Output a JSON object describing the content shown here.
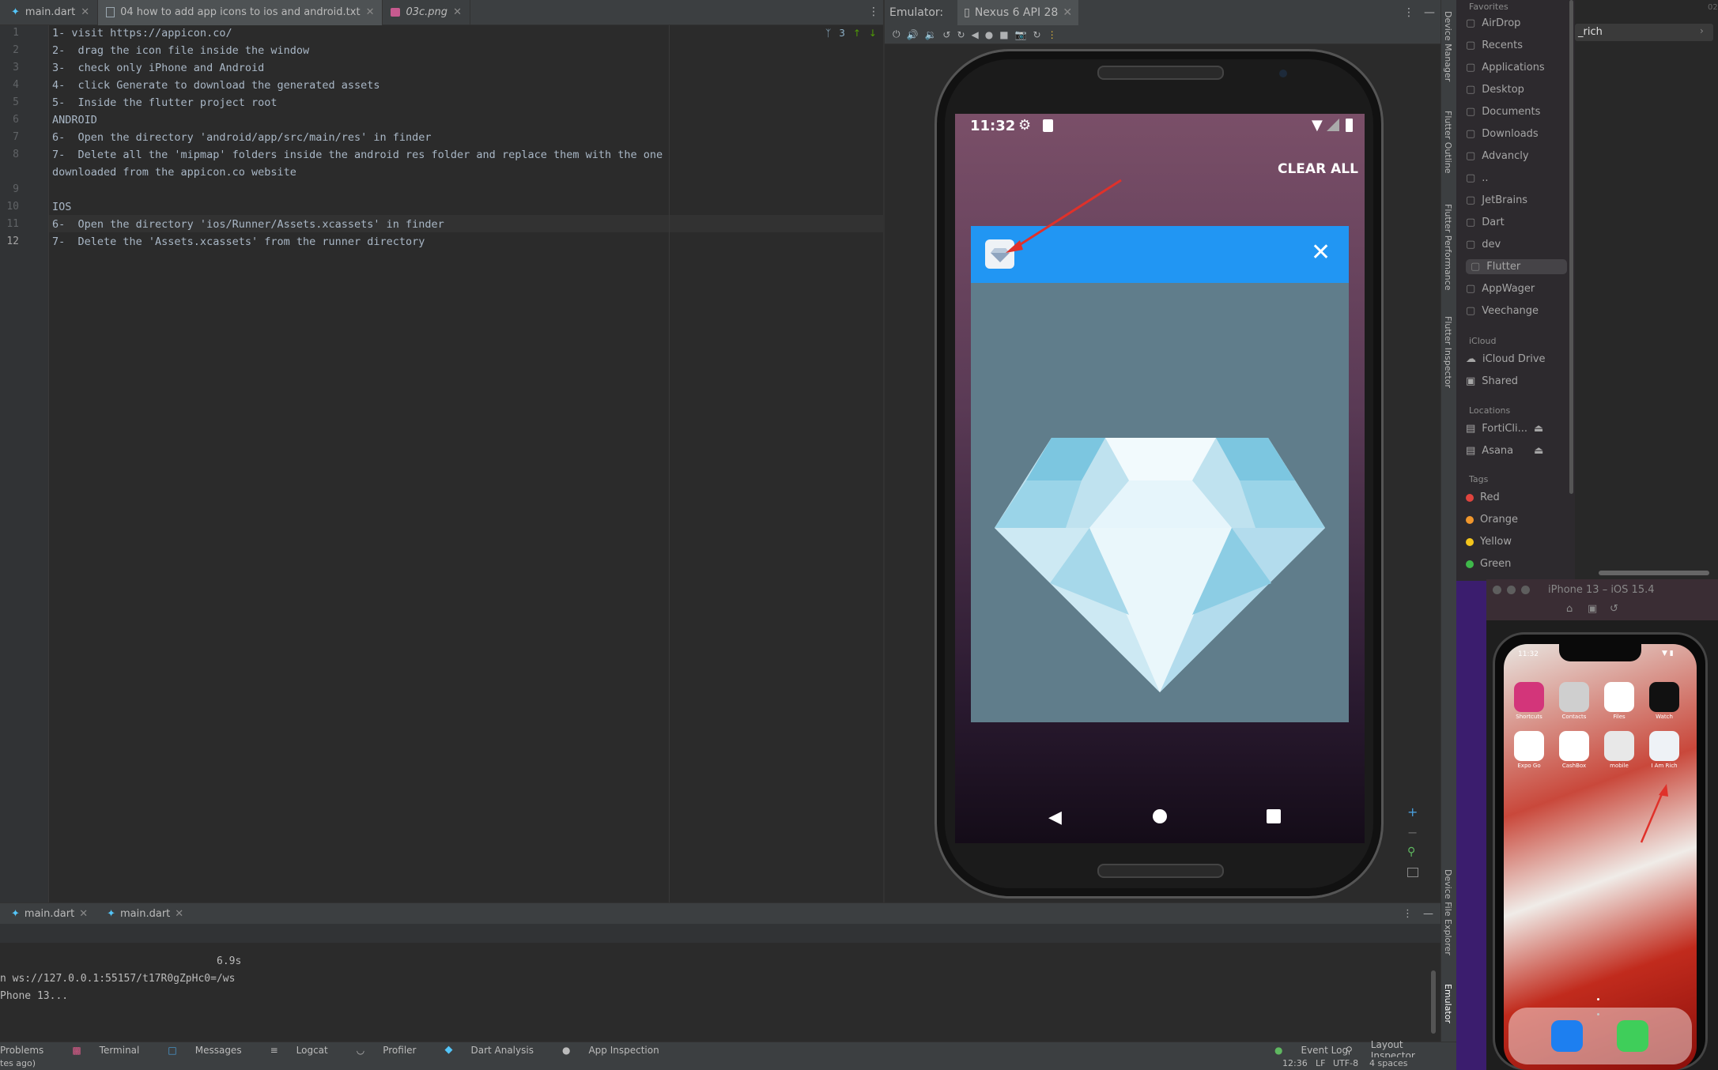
{
  "editor": {
    "tabs": [
      {
        "label": "main.dart"
      },
      {
        "label": "04 how to add app icons to ios and android.txt"
      },
      {
        "label": "03c.png"
      }
    ],
    "lines": [
      {
        "num": "1",
        "text": "1- visit https://appicon.co/"
      },
      {
        "num": "2",
        "text": "2-  drag the icon file inside the window"
      },
      {
        "num": "3",
        "text": "3-  check only iPhone and Android"
      },
      {
        "num": "4",
        "text": "4-  click Generate to download the generated assets"
      },
      {
        "num": "5",
        "text": "5-  Inside the flutter project root"
      },
      {
        "num": "6",
        "text": "ANDROID"
      },
      {
        "num": "7",
        "text": "6-  Open the directory 'android/app/src/main/res' in finder"
      },
      {
        "num": "8",
        "text": "7-  Delete all the 'mipmap' folders inside the android res folder and replace them with the one"
      },
      {
        "num": "",
        "text": "downloaded from the appicon.co website"
      },
      {
        "num": "9",
        "text": ""
      },
      {
        "num": "10",
        "text": "IOS"
      },
      {
        "num": "11",
        "text": "6-  Open the directory 'ios/Runner/Assets.xcassets' in finder"
      },
      {
        "num": "12",
        "text": "7-  Delete the 'Assets.xcassets' from the runner directory"
      }
    ],
    "inspection_count": "3"
  },
  "emulator": {
    "label": "Emulator:",
    "device_tab": "Nexus 6 API 28",
    "status_time": "11:32",
    "clear_all": "CLEAR ALL"
  },
  "bottom_panel": {
    "tabs": [
      {
        "label": "main.dart"
      },
      {
        "label": "main.dart"
      }
    ],
    "console": [
      "6.9s",
      "n ws://127.0.0.1:55157/t17R0gZpHc0=/ws",
      "Phone 13..."
    ]
  },
  "tool_windows": {
    "left": [
      "Problems",
      "Terminal",
      "Messages",
      "Logcat",
      "Profiler",
      "Dart Analysis",
      "App Inspection"
    ],
    "right": [
      "Event Log",
      "Layout Inspector"
    ]
  },
  "status_bar": {
    "left": "tes ago)",
    "time": "12:36",
    "line_sep": "LF",
    "encoding": "UTF-8",
    "indent": "4 spaces"
  },
  "right_strip": {
    "labels": [
      "Device Manager",
      "Flutter Outline",
      "Flutter Performance",
      "Flutter Inspector",
      "Device File Explorer",
      "Emulator"
    ]
  },
  "finder": {
    "favorites_header": "Favorites",
    "favorites": [
      "AirDrop",
      "Recents",
      "Applications",
      "Desktop",
      "Documents",
      "Downloads",
      "Advancly",
      "..",
      "JetBrains",
      "Dart",
      "dev",
      "Flutter",
      "AppWager",
      "Veechange"
    ],
    "icloud_header": "iCloud",
    "icloud": [
      "iCloud Drive",
      "Shared"
    ],
    "locations_header": "Locations",
    "locations": [
      "FortiCli...",
      "Asana"
    ],
    "tags_header": "Tags",
    "tags": [
      {
        "label": "Red",
        "color": "#e0443e"
      },
      {
        "label": "Orange",
        "color": "#f0962c"
      },
      {
        "label": "Yellow",
        "color": "#f4c51c"
      },
      {
        "label": "Green",
        "color": "#3fb84a"
      }
    ],
    "path_item": "_rich",
    "corner": "02"
  },
  "simulator": {
    "title": "iPhone 13 – iOS 15.4",
    "time": "11:32",
    "apps": [
      {
        "label": "Shortcuts",
        "color": "#d3357a"
      },
      {
        "label": "Contacts",
        "color": "#cfcfcf"
      },
      {
        "label": "Files",
        "color": "#ffffff"
      },
      {
        "label": "Watch",
        "color": "#111111"
      },
      {
        "label": "Expo Go",
        "color": "#ffffff"
      },
      {
        "label": "CashBox",
        "color": "#ffffff"
      },
      {
        "label": "mobile",
        "color": "#e8e8e8"
      },
      {
        "label": "I Am Rich",
        "color": "#eef2f6"
      }
    ]
  },
  "colors": {
    "notif_header": "#2196f3",
    "notif_body": "#607d8b",
    "accent_red": "#e0312a"
  }
}
